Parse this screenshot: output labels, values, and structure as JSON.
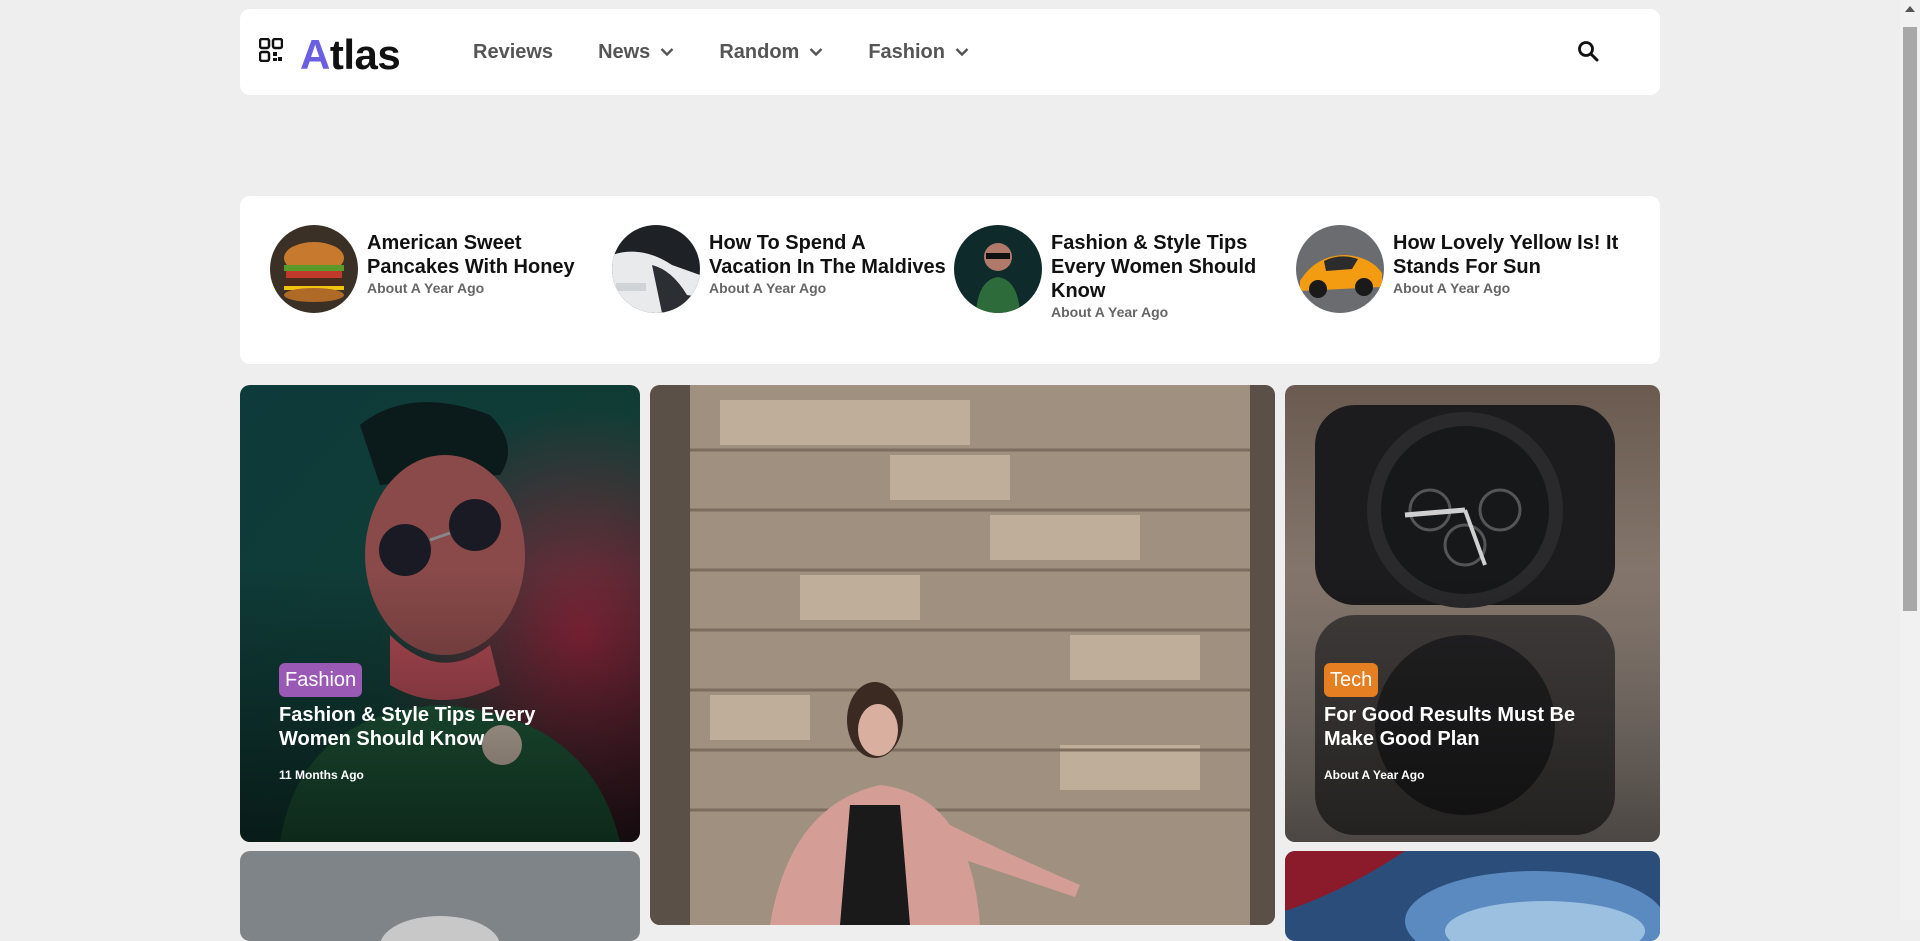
{
  "header": {
    "logo_accent": "A",
    "logo_rest": "tlas",
    "nav": [
      {
        "label": "Reviews",
        "dropdown": false
      },
      {
        "label": "News",
        "dropdown": true
      },
      {
        "label": "Random",
        "dropdown": true
      },
      {
        "label": "Fashion",
        "dropdown": true
      }
    ]
  },
  "trending": [
    {
      "title": "American Sweet Pancakes With Honey",
      "meta": "About A Year Ago",
      "thumb": "burger"
    },
    {
      "title": "How To Spend A Vacation In The Maldives",
      "meta": "About A Year Ago",
      "thumb": "car"
    },
    {
      "title": "Fashion & Style Tips Every Women Should Know",
      "meta": "About A Year Ago",
      "thumb": "man"
    },
    {
      "title": "How Lovely Yellow Is! It Stands For Sun",
      "meta": "About A Year Ago",
      "thumb": "sportscar"
    }
  ],
  "cards": [
    {
      "category": "Fashion",
      "category_color": "#9b59b6",
      "title": "Fashion & Style Tips Every Women Should Know",
      "meta": "11 Months Ago"
    },
    {
      "category": "Tech",
      "category_color": "#e67e22",
      "title": "For Good Results Must Be Make Good Plan",
      "meta": "About A Year Ago"
    }
  ],
  "colors": {
    "accent": "#6a5fe0",
    "background": "#eeeeee"
  }
}
